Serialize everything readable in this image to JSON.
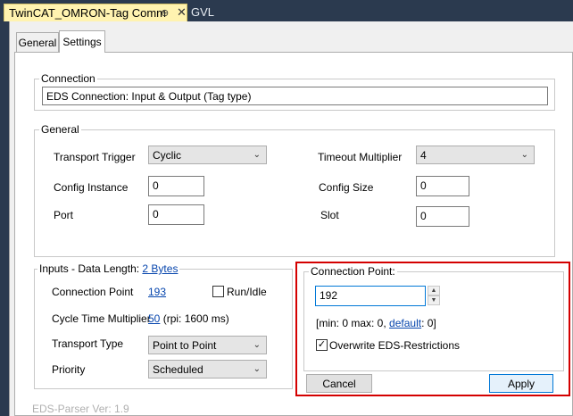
{
  "doc_tabs": [
    {
      "label": "TwinCAT_OMRON-Tag Comm",
      "pin_glyph": "⊕",
      "close_glyph": "✕"
    },
    {
      "label": "GVL"
    }
  ],
  "subtabs": [
    "General",
    "Settings"
  ],
  "connection": {
    "legend": "Connection",
    "value": "EDS Connection: Input & Output (Tag type)"
  },
  "general": {
    "legend": "General",
    "transport_trigger_label": "Transport Trigger",
    "transport_trigger_value": "Cyclic",
    "timeout_multiplier_label": "Timeout Multiplier",
    "timeout_multiplier_value": "4",
    "config_instance_label": "Config Instance",
    "config_instance_value": "0",
    "config_size_label": "Config Size",
    "config_size_value": "0",
    "port_label": "Port",
    "port_value": "0",
    "slot_label": "Slot",
    "slot_value": "0"
  },
  "inputs": {
    "legend_prefix": "Inputs - Data Length:",
    "legend_link": "2 Bytes",
    "connection_point_label": "Connection Point",
    "connection_point_value": "193",
    "run_idle_label": "Run/Idle",
    "run_idle_checked": false,
    "cycle_time_label": "Cycle Time Multiplier",
    "cycle_time_value": "50",
    "cycle_time_suffix": "(rpi: 1600 ms)",
    "transport_type_label": "Transport Type",
    "transport_type_value": "Point to Point",
    "priority_label": "Priority",
    "priority_value": "Scheduled"
  },
  "popup": {
    "legend": "Connection Point:",
    "value": "192",
    "range_prefix": "[min: 0 max: 0,",
    "range_link": "default",
    "range_suffix": ": 0]",
    "overwrite_label": "Overwrite EDS-Restrictions",
    "overwrite_checked": true,
    "cancel_label": "Cancel",
    "apply_label": "Apply"
  },
  "footer": {
    "parser_version": "EDS-Parser Ver: 1.9"
  },
  "colors": {
    "highlight_frame": "#d40000",
    "link": "#0645ad",
    "doc_tab_active": "#fff3b0"
  }
}
